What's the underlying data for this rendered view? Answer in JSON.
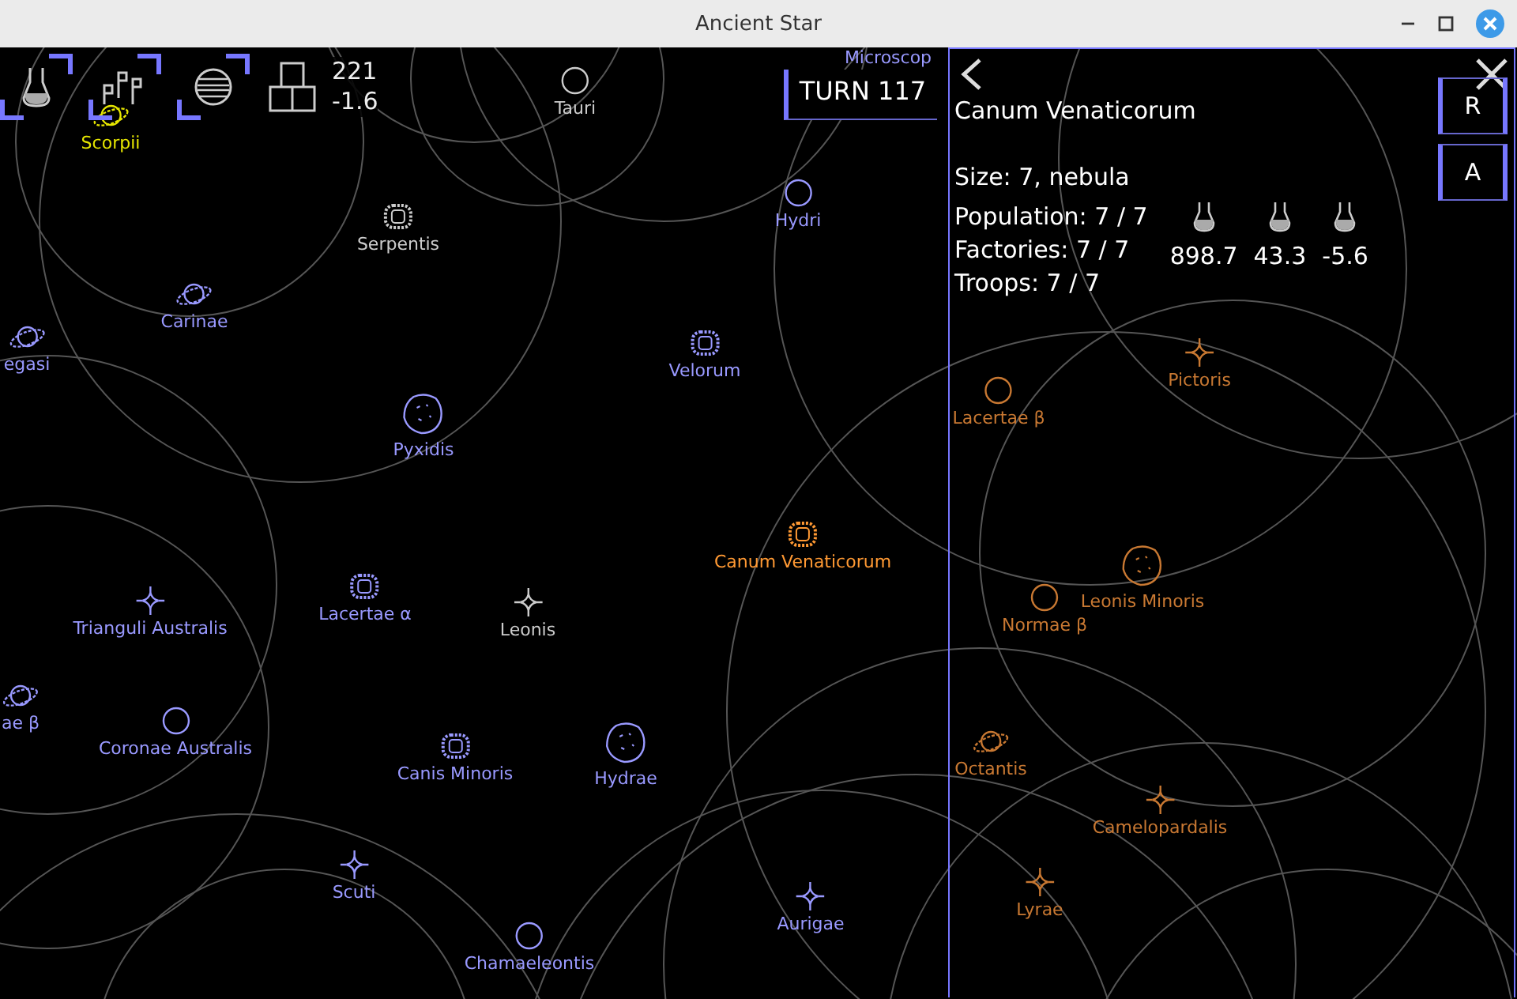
{
  "window": {
    "title": "Ancient Star"
  },
  "resources": {
    "total": "221",
    "change": "-1.6"
  },
  "turn": "TURN 117",
  "map": {
    "stars": [
      {
        "name": "Microscop",
        "kind": "none",
        "color": "#9999ff"
      },
      {
        "name": "Tauri",
        "kind": "circle",
        "color": "#cccccc"
      },
      {
        "name": "Scorpii",
        "kind": "ring",
        "color": "#e6e600"
      },
      {
        "name": "Hydri",
        "kind": "circle",
        "color": "#9999ff"
      },
      {
        "name": "Serpentis",
        "kind": "nebula",
        "color": "#cccccc"
      },
      {
        "name": "Carinae",
        "kind": "ring",
        "color": "#9999ff"
      },
      {
        "name": "egasi",
        "kind": "ring",
        "color": "#9999ff"
      },
      {
        "name": "Velorum",
        "kind": "nebula",
        "color": "#9999ff"
      },
      {
        "name": "Pictoris",
        "kind": "star",
        "color": "#c87832"
      },
      {
        "name": "Pyxidis",
        "kind": "asteroid",
        "color": "#9999ff"
      },
      {
        "name": "Lacertae β",
        "kind": "circle",
        "color": "#c87832"
      },
      {
        "name": "Canum Venaticorum",
        "kind": "nebula",
        "color": "#ff9933"
      },
      {
        "name": "Trianguli Australis",
        "kind": "star",
        "color": "#9999ff"
      },
      {
        "name": "Lacertae α",
        "kind": "nebula",
        "color": "#9999ff"
      },
      {
        "name": "Leonis",
        "kind": "star",
        "color": "#cccccc"
      },
      {
        "name": "Normae β",
        "kind": "circle",
        "color": "#c87832"
      },
      {
        "name": "Leonis Minoris",
        "kind": "asteroid",
        "color": "#c87832"
      },
      {
        "name": "ae β",
        "kind": "ring",
        "color": "#9999ff"
      },
      {
        "name": "Coronae Australis",
        "kind": "circle",
        "color": "#9999ff"
      },
      {
        "name": "Canis Minoris",
        "kind": "nebula",
        "color": "#9999ff"
      },
      {
        "name": "Hydrae",
        "kind": "asteroid",
        "color": "#9999ff"
      },
      {
        "name": "Octantis",
        "kind": "ring",
        "color": "#c87832"
      },
      {
        "name": "Camelopardalis",
        "kind": "star",
        "color": "#c87832"
      },
      {
        "name": "Scuti",
        "kind": "star",
        "color": "#9999ff"
      },
      {
        "name": "Aurigae",
        "kind": "star",
        "color": "#9999ff"
      },
      {
        "name": "Lyrae",
        "kind": "star",
        "color": "#c87832"
      },
      {
        "name": "Chamaeleontis",
        "kind": "circle",
        "color": "#9999ff"
      }
    ]
  },
  "panel": {
    "title": "Canum Venaticorum",
    "actions": [
      "R",
      "A"
    ],
    "details": [
      "Size: 7, nebula",
      "Population: 7 / 7",
      "Factories: 7 / 7",
      "Troops: 7 / 7"
    ],
    "outputs": [
      "898.7",
      "43.3",
      "-5.6"
    ]
  }
}
